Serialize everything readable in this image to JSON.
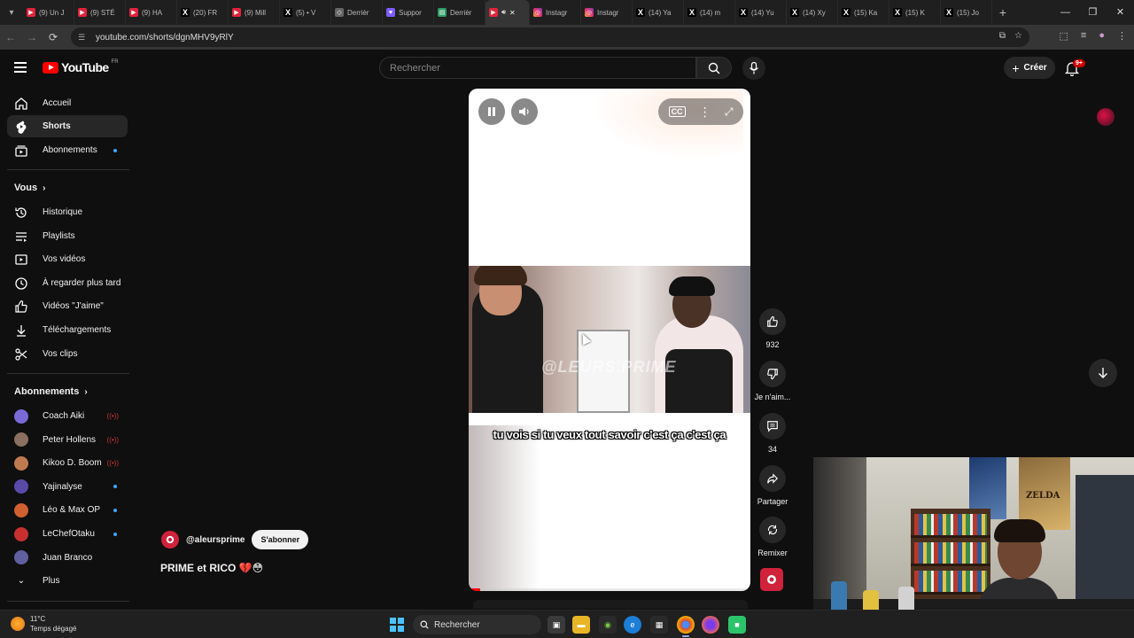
{
  "browser": {
    "tabs": [
      {
        "label": "(9) Un J",
        "icon": "youtube-icon"
      },
      {
        "label": "(9) STÉ",
        "icon": "youtube-icon"
      },
      {
        "label": "(9) HA",
        "icon": "youtube-icon"
      },
      {
        "label": "(20) FR",
        "icon": "x-icon"
      },
      {
        "label": "(9) Mill",
        "icon": "youtube-icon"
      },
      {
        "label": "(5) • V",
        "icon": "x-icon"
      },
      {
        "label": "Derrièr",
        "icon": "generic-icon"
      },
      {
        "label": "Suppor",
        "icon": "support-icon"
      },
      {
        "label": "Derrièr",
        "icon": "sheet-icon"
      },
      {
        "label": "",
        "icon": "youtube-icon",
        "active": true
      },
      {
        "label": "Instagr",
        "icon": "instagram-icon"
      },
      {
        "label": "Instagr",
        "icon": "instagram-icon"
      },
      {
        "label": "(14) Ya",
        "icon": "x-icon"
      },
      {
        "label": "(14) m",
        "icon": "x-icon"
      },
      {
        "label": "(14) Yu",
        "icon": "x-icon"
      },
      {
        "label": "(14) Xy",
        "icon": "x-icon"
      },
      {
        "label": "(15) Ka",
        "icon": "x-icon"
      },
      {
        "label": "(15) K",
        "icon": "x-icon"
      },
      {
        "label": "(15) Jo",
        "icon": "x-icon"
      }
    ],
    "url": "youtube.com/shorts/dgnMHV9yRlY"
  },
  "masthead": {
    "logo_text": "YouTube",
    "country_code": "FR",
    "search_placeholder": "Rechercher",
    "create_label": "Créer",
    "notification_count": "9+"
  },
  "sidebar": {
    "main": [
      {
        "label": "Accueil",
        "icon": "home-icon"
      },
      {
        "label": "Shorts",
        "icon": "shorts-icon",
        "active": true
      },
      {
        "label": "Abonnements",
        "icon": "subscriptions-icon"
      }
    ],
    "you_title": "Vous",
    "you": [
      {
        "label": "Historique",
        "icon": "history-icon"
      },
      {
        "label": "Playlists",
        "icon": "playlists-icon"
      },
      {
        "label": "Vos vidéos",
        "icon": "your-videos-icon"
      },
      {
        "label": "À regarder plus tard",
        "icon": "watch-later-icon"
      },
      {
        "label": "Vidéos \"J'aime\"",
        "icon": "liked-icon"
      },
      {
        "label": "Téléchargements",
        "icon": "downloads-icon"
      },
      {
        "label": "Vos clips",
        "icon": "clips-icon"
      }
    ],
    "subs_title": "Abonnements",
    "subscriptions": [
      {
        "name": "Coach Aiki",
        "status": "live",
        "color": "#7a6ad8"
      },
      {
        "name": "Peter Hollens",
        "status": "live",
        "color": "#8a7060"
      },
      {
        "name": "Kikoo D. Boom",
        "status": "live",
        "color": "#c07a50"
      },
      {
        "name": "Yajinalyse",
        "status": "new",
        "color": "#5a4aa8"
      },
      {
        "name": "Léo & Max OP",
        "status": "new",
        "color": "#d06030"
      },
      {
        "name": "LeChefOtaku",
        "status": "new",
        "color": "#c83030"
      },
      {
        "name": "Juan Branco",
        "status": "",
        "color": "#6060a0"
      }
    ],
    "more_label": "Plus"
  },
  "video": {
    "caption": "tu vois si tu veux tout savoir c'est ça c'est ça",
    "watermark": "@LEURS.PRIME",
    "progress": 0.04
  },
  "actions": {
    "like_count": "932",
    "dislike_label": "Je n'aim...",
    "comment_count": "34",
    "share_label": "Partager",
    "remix_label": "Remixer"
  },
  "channel": {
    "handle": "@aleursprime",
    "subscribe_label": "S'abonner",
    "title": "PRIME et RICO 💔😳"
  },
  "webcam": {
    "poster_text": "ZELDA"
  },
  "taskbar": {
    "temperature": "11°C",
    "weather_desc": "Temps dégagé",
    "search_label": "Rechercher"
  }
}
